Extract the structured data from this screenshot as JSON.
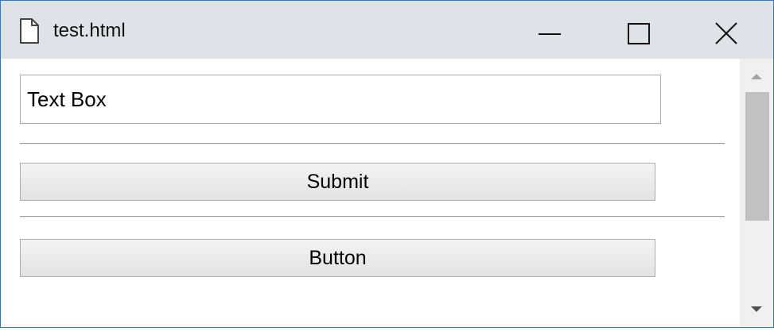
{
  "window": {
    "title": "test.html",
    "icons": {
      "file": "file-icon",
      "minimize": "minimize-icon",
      "maximize": "maximize-icon",
      "close": "close-icon"
    }
  },
  "form": {
    "text_box_value": "Text Box",
    "submit_label": "Submit",
    "button_label": "Button"
  },
  "scrollbar": {
    "up": "scroll-up-arrow-icon",
    "down": "scroll-down-arrow-icon"
  },
  "colors": {
    "window_border": "#2b79c6",
    "titlebar_bg": "#dfe3e8",
    "scrollbar_track": "#f0f0f0",
    "scrollbar_thumb": "#c1c1c1"
  }
}
